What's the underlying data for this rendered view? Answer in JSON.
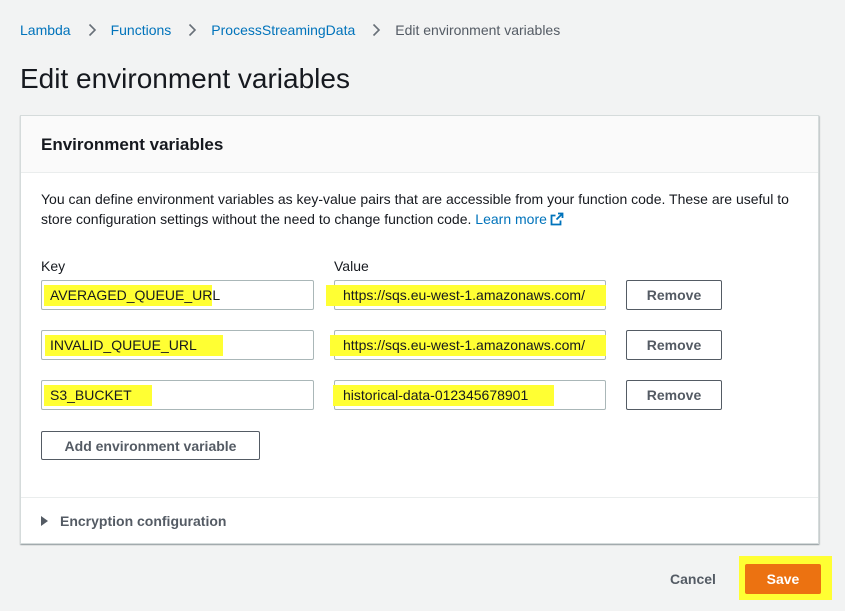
{
  "breadcrumb": {
    "items": [
      "Lambda",
      "Functions",
      "ProcessStreamingData"
    ],
    "current": "Edit environment variables"
  },
  "page": {
    "title": "Edit environment variables"
  },
  "panel": {
    "title": "Environment variables",
    "description": "You can define environment variables as key-value pairs that are accessible from your function code. These are useful to store configuration settings without the need to change function code.",
    "learn_more": "Learn more",
    "key_label": "Key",
    "value_label": "Value",
    "variables": [
      {
        "key": "AVERAGED_QUEUE_URL",
        "value": "https://sqs.eu-west-1.amazonaws.com/"
      },
      {
        "key": "INVALID_QUEUE_URL",
        "value": "https://sqs.eu-west-1.amazonaws.com/"
      },
      {
        "key": "S3_BUCKET",
        "value": "historical-data-012345678901"
      }
    ],
    "remove_label": "Remove",
    "add_label": "Add environment variable",
    "encryption_label": "Encryption configuration"
  },
  "footer": {
    "cancel_label": "Cancel",
    "save_label": "Save"
  },
  "colors": {
    "link": "#0073bb",
    "primary": "#ec7211",
    "highlight": "#ffff33"
  }
}
